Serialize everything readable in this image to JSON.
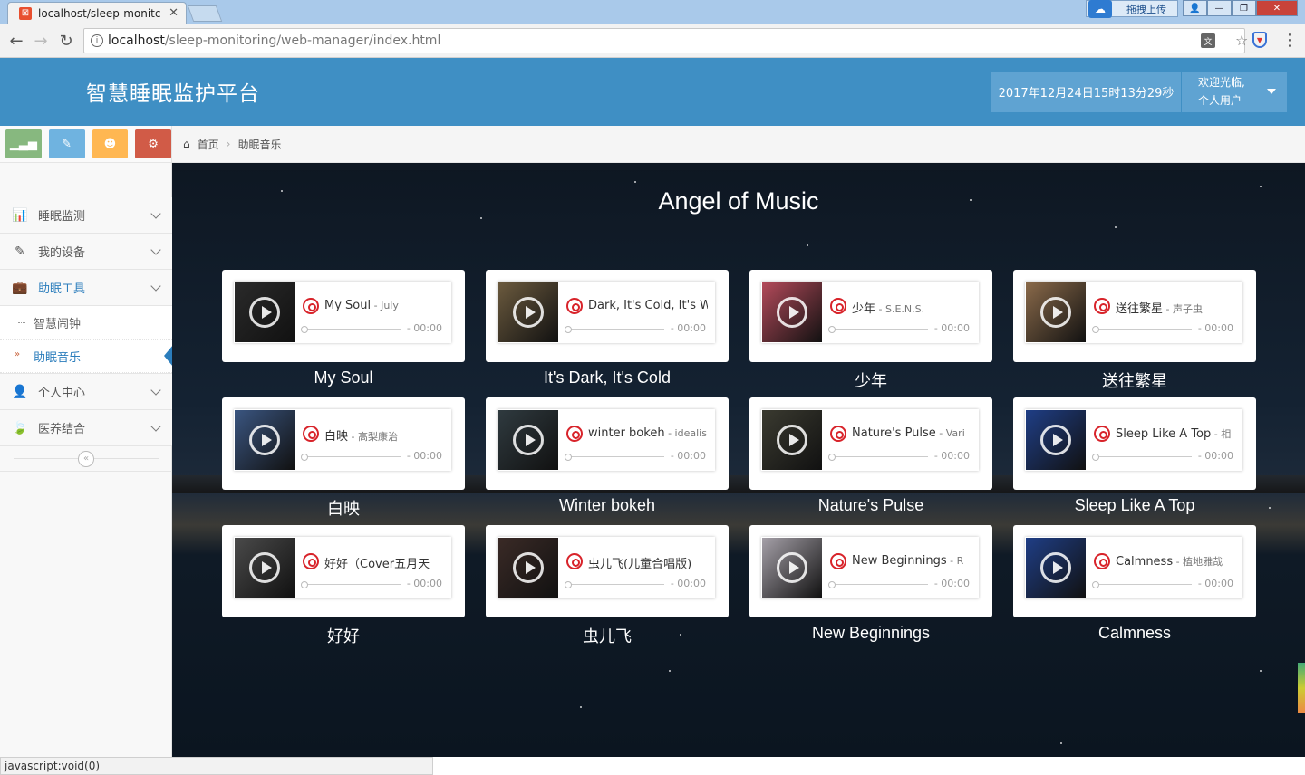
{
  "browser": {
    "tab_title": "localhost/sleep-monitc",
    "url_host": "localhost",
    "url_path": "/sleep-monitoring/web-manager/index.html",
    "extension_label": "拖拽上传",
    "status_text": "javascript:void(0)"
  },
  "header": {
    "title": "智慧睡眠监护平台",
    "datetime": "2017年12月24日15时13分29秒",
    "welcome": "欢迎光临,",
    "user_name": "个人用户"
  },
  "sidebar": {
    "shortcut_colors": [
      "#87b87f",
      "#6fb3e0",
      "#ffb752",
      "#d15b47"
    ],
    "items": [
      {
        "label": "睡眠监测",
        "icon": "bar-chart-icon"
      },
      {
        "label": "我的设备",
        "icon": "pencil-icon"
      },
      {
        "label": "助眠工具",
        "icon": "briefcase-icon"
      },
      {
        "label": "个人中心",
        "icon": "user-icon"
      },
      {
        "label": "医养结合",
        "icon": "leaf-icon"
      }
    ],
    "sub_items": [
      {
        "label": "智慧闹钟"
      },
      {
        "label": "助眠音乐"
      }
    ]
  },
  "breadcrumb": {
    "home": "首页",
    "current": "助眠音乐"
  },
  "main": {
    "title": "Angel of Music",
    "cards": [
      {
        "song": "My Soul",
        "artist": "July",
        "time": "- 00:00",
        "caption": "My Soul",
        "cover": "#2a2a2a"
      },
      {
        "song": "Dark, It's Cold, It's W",
        "artist": "",
        "time": "- 00:00",
        "caption": "It's Dark, It's Cold",
        "cover": "#6b5a3e"
      },
      {
        "song": "少年",
        "artist": "S.E.N.S.",
        "time": "- 00:00",
        "caption": "少年",
        "cover": "#b34a5a"
      },
      {
        "song": "送往繁星",
        "artist": "声子虫",
        "time": "- 00:00",
        "caption": "送往繁星",
        "cover": "#8a6a4a"
      },
      {
        "song": "白映",
        "artist": "高梨康治",
        "time": "- 00:00",
        "caption": "白映",
        "cover": "#3a5580"
      },
      {
        "song": "winter bokeh",
        "artist": "idealis",
        "time": "- 00:00",
        "caption": "Winter bokeh",
        "cover": "#2f3a3f"
      },
      {
        "song": "Nature's Pulse",
        "artist": "Vari",
        "time": "- 00:00",
        "caption": "Nature's Pulse",
        "cover": "#3a3a30"
      },
      {
        "song": "Sleep Like A Top",
        "artist": "相",
        "time": "- 00:00",
        "caption": "Sleep Like A Top",
        "cover": "#1f3e86"
      },
      {
        "song": "好好（Cover五月天",
        "artist": "",
        "time": "- 00:00",
        "caption": "好好",
        "cover": "#4a4a4a"
      },
      {
        "song": "虫儿飞(儿童合唱版)",
        "artist": "",
        "time": "- 00:00",
        "caption": "虫儿飞",
        "cover": "#3a2a26"
      },
      {
        "song": "New Beginnings",
        "artist": "R",
        "time": "- 00:00",
        "caption": "New Beginnings",
        "cover": "#a5a0a8"
      },
      {
        "song": "Calmness",
        "artist": "植地雅哉",
        "time": "- 00:00",
        "caption": "Calmness",
        "cover": "#1f3e86"
      }
    ]
  }
}
